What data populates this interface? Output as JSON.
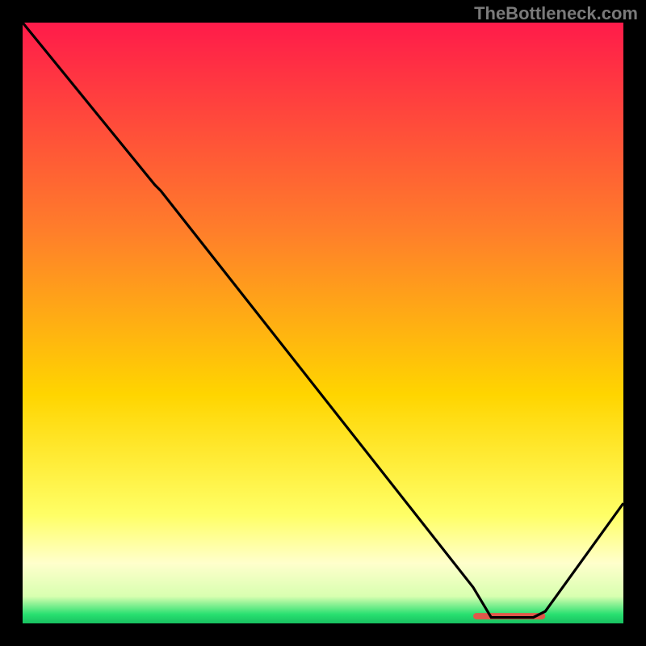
{
  "watermark": "TheBottleneck.com",
  "colors": {
    "top": "#ff1b4a",
    "mid_upper": "#ff7f2a",
    "mid": "#ffd500",
    "mid_lower": "#ffff66",
    "pale": "#ffffcc",
    "green": "#28e070",
    "line": "#000000",
    "marker": "#e0584a",
    "bg": "#000000"
  },
  "chart_data": {
    "type": "line",
    "title": "",
    "xlabel": "",
    "ylabel": "",
    "xlim": [
      0,
      100
    ],
    "ylim": [
      0,
      100
    ],
    "x": [
      0,
      22,
      23,
      75,
      78,
      85,
      87,
      100
    ],
    "values": [
      100,
      73,
      72,
      6,
      1,
      1,
      2,
      20
    ],
    "marker_band": {
      "x_start": 75,
      "x_end": 87,
      "y": 1.2
    },
    "gradient_stops": [
      {
        "offset": 0.0,
        "color": "#ff1b4a"
      },
      {
        "offset": 0.35,
        "color": "#ff7f2a"
      },
      {
        "offset": 0.62,
        "color": "#ffd500"
      },
      {
        "offset": 0.82,
        "color": "#ffff66"
      },
      {
        "offset": 0.9,
        "color": "#ffffcc"
      },
      {
        "offset": 0.955,
        "color": "#d8ffb0"
      },
      {
        "offset": 0.985,
        "color": "#28e070"
      },
      {
        "offset": 1.0,
        "color": "#18c060"
      }
    ]
  }
}
